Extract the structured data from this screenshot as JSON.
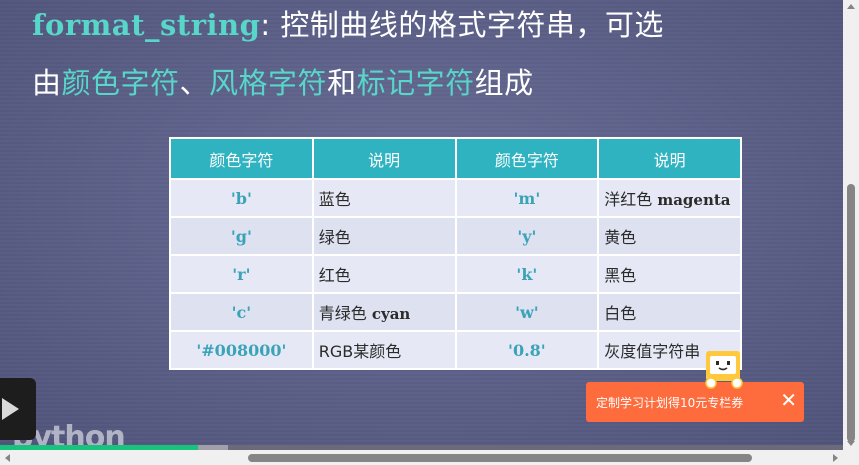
{
  "slide": {
    "title_keyword": "format_string",
    "title_rest": ": 控制曲线的格式字符串，可选",
    "line2": [
      {
        "text": "由",
        "hl": false
      },
      {
        "text": "颜色字符",
        "hl": true
      },
      {
        "text": "、",
        "hl": false
      },
      {
        "text": "风格字符",
        "hl": true
      },
      {
        "text": "和",
        "hl": false
      },
      {
        "text": "标记字符",
        "hl": true
      },
      {
        "text": "组成",
        "hl": false
      }
    ],
    "table": {
      "headers": [
        "颜色字符",
        "说明",
        "颜色字符",
        "说明"
      ],
      "rows": [
        {
          "c1": "'b'",
          "d1": "蓝色",
          "d1_en": "",
          "c2": "'m'",
          "d2": "洋红色 ",
          "d2_en": "magenta"
        },
        {
          "c1": "'g'",
          "d1": "绿色",
          "d1_en": "",
          "c2": "'y'",
          "d2": "黄色",
          "d2_en": ""
        },
        {
          "c1": "'r'",
          "d1": "红色",
          "d1_en": "",
          "c2": "'k'",
          "d2": "黑色",
          "d2_en": ""
        },
        {
          "c1": "'c'",
          "d1": "青绿色 ",
          "d1_en": "cyan",
          "c2": "'w'",
          "d2": "白色",
          "d2_en": ""
        },
        {
          "c1": "'#008000'",
          "d1": "RGB某颜色",
          "d1_en": "",
          "c2": "'0.8'",
          "d2": "灰度值字符串",
          "d2_en": ""
        }
      ]
    },
    "watermark": "python"
  },
  "player": {
    "play_icon": "play-icon",
    "progress": {
      "played_fraction": 0.235,
      "buffered_fraction": 0.27
    }
  },
  "promo": {
    "text": "定制学习计划得10元专栏券",
    "close": "✕",
    "mascot_icon": "mascot-icon"
  },
  "colors": {
    "accent": "#57d6c9",
    "table_header": "#2fb3c1",
    "promo_bg": "#fe6b3c",
    "progress": "#19c37d"
  }
}
